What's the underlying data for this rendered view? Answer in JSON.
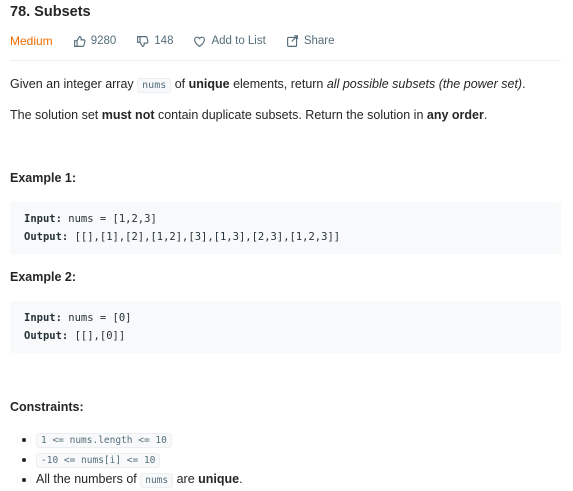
{
  "problem": {
    "title": "78. Subsets",
    "difficulty": "Medium",
    "likes": "9280",
    "dislikes": "148",
    "add_to_list": "Add to List",
    "share": "Share"
  },
  "description": {
    "p1": {
      "t1": "Given an integer array ",
      "code": "nums",
      "t2": " of ",
      "b1": "unique",
      "t3": " elements, return ",
      "i1": "all possible subsets (the power set)",
      "t4": "."
    },
    "p2": {
      "t1": "The solution set ",
      "b1": "must not",
      "t2": " contain duplicate subsets. Return the solution in ",
      "b2": "any order",
      "t3": "."
    }
  },
  "examples": [
    {
      "heading": "Example 1:",
      "input_label": "Input:",
      "input_value": " nums = [1,2,3]",
      "output_label": "Output:",
      "output_value": " [[],[1],[2],[1,2],[3],[1,3],[2,3],[1,2,3]]"
    },
    {
      "heading": "Example 2:",
      "input_label": "Input:",
      "input_value": " nums = [0]",
      "output_label": "Output:",
      "output_value": " [[],[0]]"
    }
  ],
  "constraints": {
    "heading": "Constraints:",
    "c1": "1 <= nums.length <= 10",
    "c2": "-10 <= nums[i] <= 10",
    "c3": {
      "t1": "All the numbers of ",
      "code": "nums",
      "t2": " are ",
      "b1": "unique",
      "t3": "."
    }
  },
  "colors": {
    "difficulty": "#ef6c00",
    "meta_text": "#546e7a",
    "code_bg": "#f7f9fa"
  },
  "icons": {
    "likes": "thumbs-up-icon",
    "dislikes": "thumbs-down-icon",
    "add_to_list": "heart-icon",
    "share": "share-icon"
  }
}
